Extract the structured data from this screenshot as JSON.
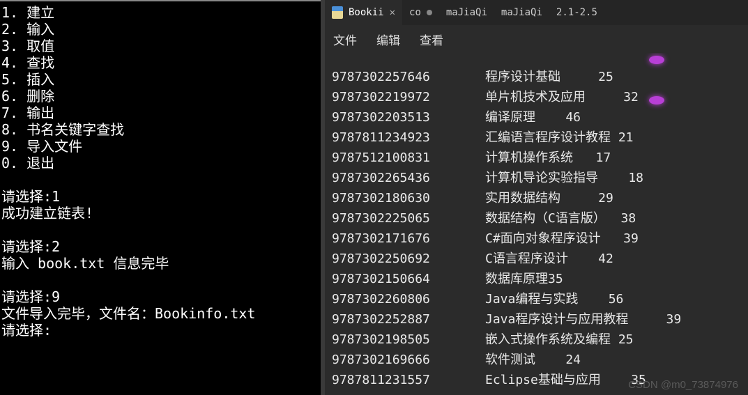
{
  "terminal": {
    "menu": [
      {
        "num": "1",
        "label": "建立"
      },
      {
        "num": "2",
        "label": "输入"
      },
      {
        "num": "3",
        "label": "取值"
      },
      {
        "num": "4",
        "label": "查找"
      },
      {
        "num": "5",
        "label": "插入"
      },
      {
        "num": "6",
        "label": "删除"
      },
      {
        "num": "7",
        "label": "输出"
      },
      {
        "num": "8",
        "label": "书名关键字查找"
      },
      {
        "num": "9",
        "label": "导入文件"
      },
      {
        "num": "0",
        "label": "退出"
      }
    ],
    "interactions": [
      "",
      "请选择:1",
      "成功建立链表!",
      "",
      "请选择:2",
      "输入 book.txt 信息完毕",
      "",
      "请选择:9",
      "文件导入完毕，文件名：Bookinfo.txt",
      "请选择:"
    ]
  },
  "editor": {
    "tabs": [
      {
        "label": "Bookii",
        "active": true,
        "close": true
      },
      {
        "label": "co",
        "modified": true
      },
      {
        "label": "maJiaQi"
      },
      {
        "label": "maJiaQi"
      },
      {
        "label": "2.1-2.5"
      }
    ],
    "menus": [
      "文件",
      "编辑",
      "查看"
    ],
    "books": [
      {
        "isbn": "9787302257646",
        "rest": "程序设计基础     25"
      },
      {
        "isbn": "9787302219972",
        "rest": "单片机技术及应用     32"
      },
      {
        "isbn": "9787302203513",
        "rest": "编译原理    46"
      },
      {
        "isbn": "9787811234923",
        "rest": "汇编语言程序设计教程 21"
      },
      {
        "isbn": "9787512100831",
        "rest": "计算机操作系统   17"
      },
      {
        "isbn": "9787302265436",
        "rest": "计算机导论实验指导    18"
      },
      {
        "isbn": "9787302180630",
        "rest": "实用数据结构     29"
      },
      {
        "isbn": "9787302225065",
        "rest": "数据结构（C语言版）  38"
      },
      {
        "isbn": "9787302171676",
        "rest": "C#面向对象程序设计   39"
      },
      {
        "isbn": "9787302250692",
        "rest": "C语言程序设计    42"
      },
      {
        "isbn": "9787302150664",
        "rest": "数据库原理35"
      },
      {
        "isbn": "9787302260806",
        "rest": "Java编程与实践    56"
      },
      {
        "isbn": "9787302252887",
        "rest": "Java程序设计与应用教程     39"
      },
      {
        "isbn": "9787302198505",
        "rest": "嵌入式操作系统及编程 25"
      },
      {
        "isbn": "9787302169666",
        "rest": "软件测试    24"
      },
      {
        "isbn": "9787811231557",
        "rest": "Eclipse基础与应用    35"
      }
    ],
    "watermark": "CSDN @m0_73874976"
  }
}
